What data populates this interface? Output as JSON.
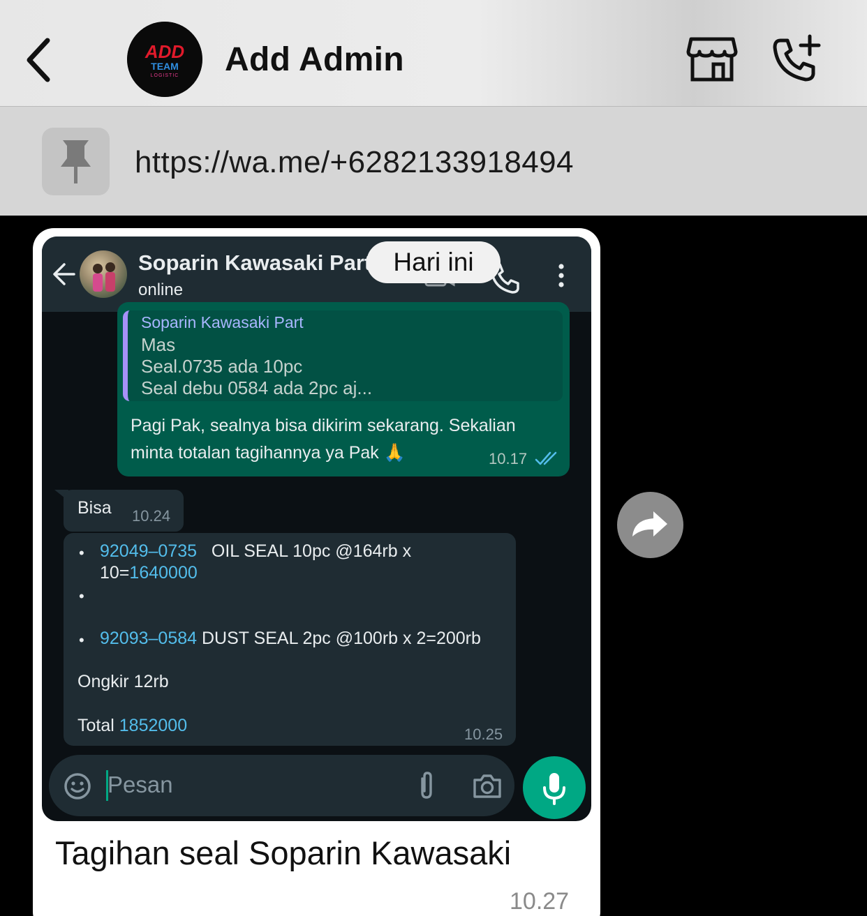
{
  "header": {
    "title": "Add Admin",
    "avatar_brand": "ADD",
    "avatar_sub": "TEAM",
    "avatar_tag": "LOGISTIC"
  },
  "pinned": {
    "text": "https://wa.me/+6282133918494"
  },
  "forwarded": {
    "day_label": "Hari ini",
    "contact_name": "Soparin Kawasaki Part",
    "contact_status": "online",
    "quote": {
      "name": "Soparin Kawasaki Part",
      "lines": [
        "Mas",
        "Seal.0735 ada 10pc",
        "Seal debu 0584 ada 2pc aj..."
      ]
    },
    "outgoing": {
      "text": "Pagi Pak, sealnya bisa dikirim sekarang. Sekalian minta totalan tagihannya ya Pak 🙏",
      "time": "10.17"
    },
    "reply": {
      "text": "Bisa",
      "time": "10.24"
    },
    "invoice": {
      "item1_code": "92049–0735",
      "item1_desc": "OIL SEAL 10pc @164rb x",
      "item1_desc2": "10=",
      "item1_total": "1640000",
      "item2_code": "92093–0584",
      "item2_desc": "DUST SEAL 2pc @100rb x 2=200rb",
      "ongkir": "Ongkir 12rb",
      "total_label": "Total ",
      "total_value": "1852000",
      "time": "10.25"
    },
    "input_placeholder": "Pesan"
  },
  "message": {
    "caption": "Tagihan seal Soparin Kawasaki",
    "time": "10.27"
  },
  "colors": {
    "wa_outgoing": "#005c4b",
    "wa_incoming": "#1f2c33",
    "wa_accent": "#00a884",
    "link": "#53bdeb"
  }
}
